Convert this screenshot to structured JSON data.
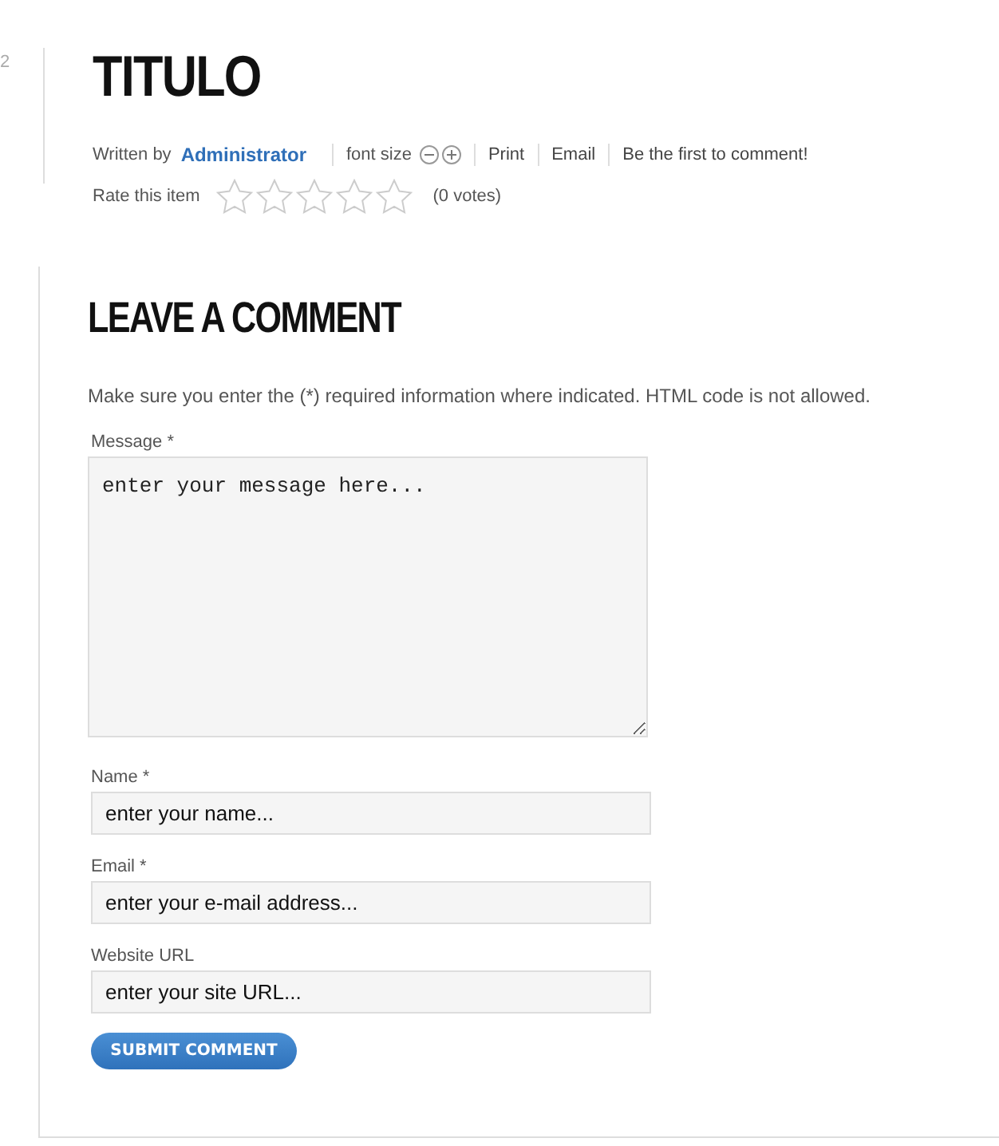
{
  "page_number": "2",
  "article": {
    "title": "TITULO",
    "written_by_label": "Written by",
    "author": "Administrator",
    "font_size_label": "font size",
    "links": [
      "Print",
      "Email",
      "Be the first to comment!"
    ],
    "rate_label": "Rate this item",
    "stars": 0,
    "votes": "(0 votes)"
  },
  "comment_form": {
    "heading": "LEAVE A COMMENT",
    "note": "Make sure you enter the (*) required information where indicated. HTML code is not allowed.",
    "fields": [
      {
        "kind": "textarea",
        "label": "Message *",
        "value": "enter your message here..."
      },
      {
        "kind": "input",
        "label": "Name *",
        "value": "enter your name..."
      },
      {
        "kind": "input",
        "label": "Email *",
        "value": "enter your e-mail address..."
      },
      {
        "kind": "input",
        "label": "Website URL",
        "value": "enter your site URL..."
      }
    ],
    "submit": "SUBMIT COMMENT"
  }
}
